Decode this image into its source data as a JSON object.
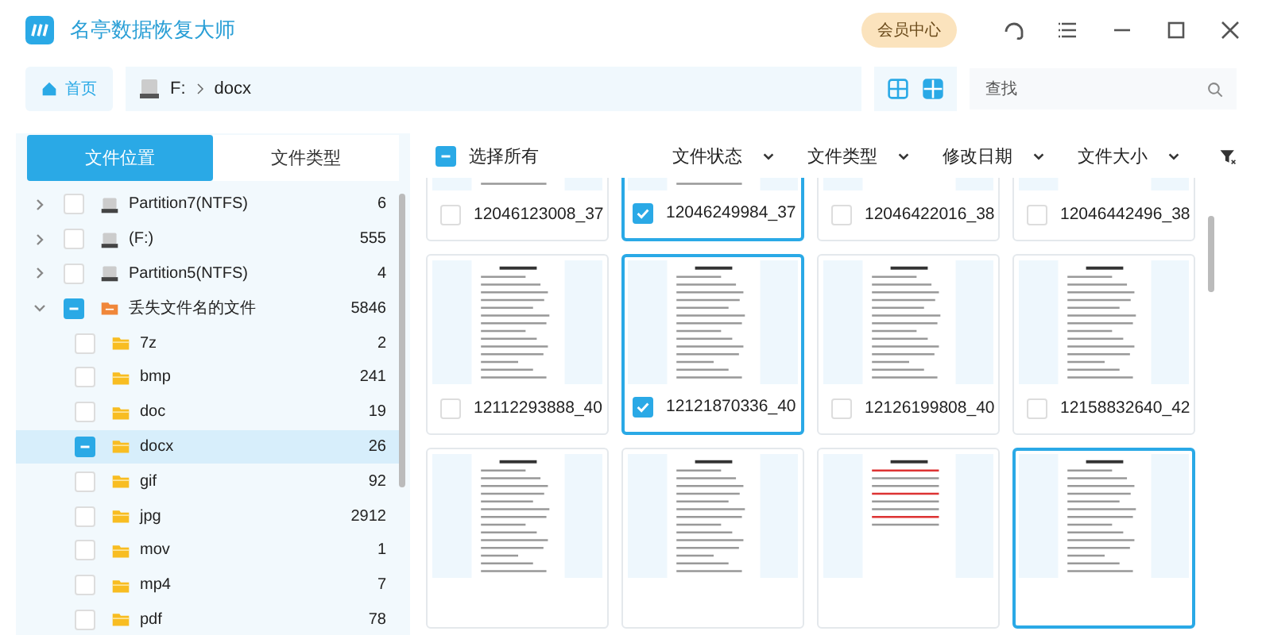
{
  "window": {
    "title": "名亭数据恢复大师",
    "member_button": "会员中心"
  },
  "address_bar": {
    "home": "首页",
    "path": [
      {
        "label": "F:",
        "kind": "drive"
      },
      {
        "label": "docx",
        "kind": "folder"
      }
    ],
    "views": [
      {
        "selected": true
      },
      {
        "selected": false
      }
    ],
    "search": {
      "placeholder": "查找"
    }
  },
  "sidebar": {
    "tabs": [
      {
        "label": "文件位置",
        "selected": true
      },
      {
        "label": "文件类型",
        "selected": false
      }
    ],
    "tree": [
      {
        "label": "Partition7(NTFS)",
        "count": "6",
        "kind": "drive",
        "expanded": false,
        "checked": false,
        "partial": false,
        "selected": false
      },
      {
        "label": "(F:)",
        "count": "555",
        "kind": "drive",
        "expanded": false,
        "checked": false,
        "partial": false,
        "selected": false
      },
      {
        "label": "Partition5(NTFS)",
        "count": "4",
        "kind": "drive",
        "expanded": false,
        "checked": false,
        "partial": false,
        "selected": false
      },
      {
        "label": "丢失文件名的文件",
        "count": "5846",
        "kind": "lost",
        "expanded": true,
        "partial": true,
        "selected": false,
        "children": [
          {
            "label": "7z",
            "count": "2",
            "kind": "folder",
            "checked": false,
            "partial": false,
            "selected": false
          },
          {
            "label": "bmp",
            "count": "241",
            "kind": "folder",
            "checked": false,
            "partial": false,
            "selected": false
          },
          {
            "label": "doc",
            "count": "19",
            "kind": "folder",
            "checked": false,
            "partial": false,
            "selected": false
          },
          {
            "label": "docx",
            "count": "26",
            "kind": "folder",
            "partial": true,
            "selected": true
          },
          {
            "label": "gif",
            "count": "92",
            "kind": "folder",
            "checked": false,
            "partial": false,
            "selected": false
          },
          {
            "label": "jpg",
            "count": "2912",
            "kind": "folder",
            "checked": false,
            "partial": false,
            "selected": false
          },
          {
            "label": "mov",
            "count": "1",
            "kind": "folder",
            "checked": false,
            "partial": false,
            "selected": false
          },
          {
            "label": "mp4",
            "count": "7",
            "kind": "folder",
            "checked": false,
            "partial": false,
            "selected": false
          },
          {
            "label": "pdf",
            "count": "78",
            "kind": "folder",
            "checked": false,
            "partial": false,
            "selected": false
          }
        ]
      }
    ]
  },
  "toolbar": {
    "select_all": {
      "label": "选择所有",
      "partial": true
    },
    "filters": [
      "文件状态",
      "文件类型",
      "修改日期",
      "文件大小"
    ]
  },
  "files": [
    {
      "name": "12046123008_37",
      "checked": false,
      "selected": false,
      "kind": "text"
    },
    {
      "name": "12046249984_37",
      "checked": true,
      "selected": true,
      "kind": "text"
    },
    {
      "name": "12046422016_38",
      "checked": false,
      "selected": false,
      "kind": "form"
    },
    {
      "name": "12046442496_38",
      "checked": false,
      "selected": false,
      "kind": "form"
    },
    {
      "name": "12112293888_40",
      "checked": false,
      "selected": false,
      "kind": "text"
    },
    {
      "name": "12121870336_40",
      "checked": true,
      "selected": true,
      "kind": "text"
    },
    {
      "name": "12126199808_40",
      "checked": false,
      "selected": false,
      "kind": "text"
    },
    {
      "name": "12158832640_42",
      "checked": false,
      "selected": false,
      "kind": "text"
    },
    {
      "selected": false,
      "kind": "text"
    },
    {
      "selected": false,
      "kind": "text"
    },
    {
      "selected": false,
      "kind": "red"
    },
    {
      "selected": true,
      "kind": "text"
    }
  ]
}
